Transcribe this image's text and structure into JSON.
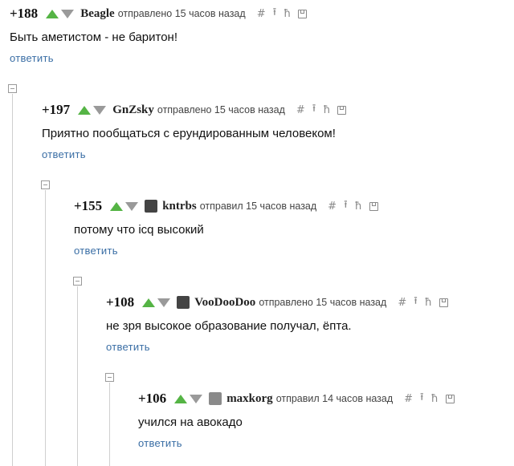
{
  "comments": [
    {
      "rating": "+188",
      "author": "Beagle",
      "meta": "отправлено 15 часов назад",
      "text": "Быть аметистом - не баритон!",
      "reply": "ответить",
      "avatar": ""
    },
    {
      "rating": "+197",
      "author": "GnZsky",
      "meta": "отправлено 15 часов назад",
      "text": "Приятно пообщаться с ерундированным человеком!",
      "reply": "ответить",
      "avatar": ""
    },
    {
      "rating": "+155",
      "author": "kntrbs",
      "meta": "отправил 15 часов назад",
      "text": "потому что icq высокий",
      "reply": "ответить",
      "avatar": "avatar-icon"
    },
    {
      "rating": "+108",
      "author": "VooDooDoo",
      "meta": "отправлено 15 часов назад",
      "text": "не зря высокое образование получал, ёпта.",
      "reply": "ответить",
      "avatar": "avatar-icon"
    },
    {
      "rating": "+106",
      "author": "maxkorg",
      "meta": "отправил 14 часов назад",
      "text": "учился на авокадо",
      "reply": "ответить",
      "avatar": "avatar-icon"
    }
  ],
  "icons": {
    "hash": "#",
    "up": "⭱",
    "parent": "ħ"
  },
  "colors": {
    "upvote": "#55b445",
    "downvote": "#9a9a9a",
    "reply_link": "#3a6ea5"
  }
}
